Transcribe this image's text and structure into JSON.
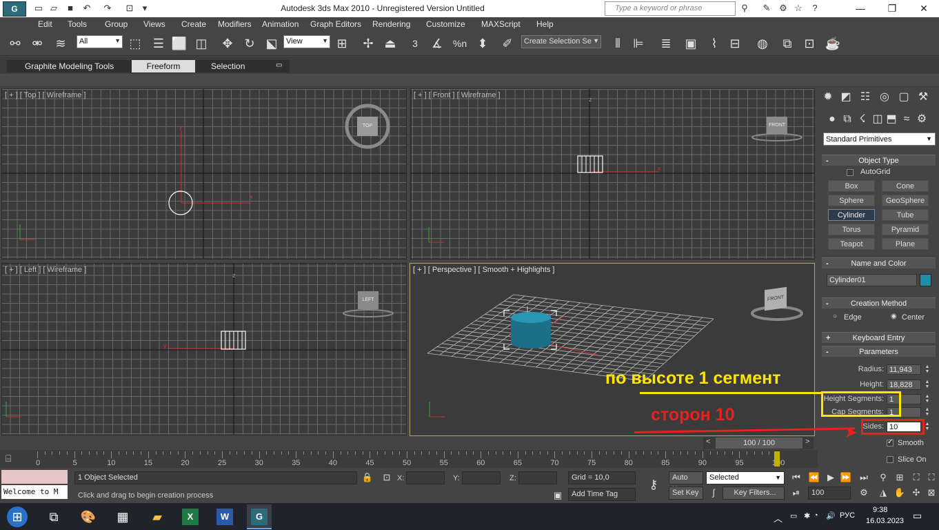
{
  "window": {
    "title": "Autodesk 3ds Max  2010   - Unregistered Version     Untitled",
    "search_placeholder": "Type a keyword or phrase"
  },
  "menu": [
    "Edit",
    "Tools",
    "Group",
    "Views",
    "Create",
    "Modifiers",
    "Animation",
    "Graph Editors",
    "Rendering",
    "Customize",
    "MAXScript",
    "Help"
  ],
  "toolbar": {
    "selection_filter": "All",
    "reference_coord": "View",
    "named_selection": "Create Selection Se",
    "snap_label": "3",
    "percent_snap": "%n"
  },
  "ribbon": {
    "tabs": [
      "Graphite Modeling Tools",
      "Freeform",
      "Selection"
    ],
    "active_tab": "Freeform"
  },
  "viewports": {
    "top": "[ + ] [ Top ] [ Wireframe ]",
    "front": "[ + ] [ Front ] [ Wireframe ]",
    "left": "[ + ] [ Left ] [ Wireframe ]",
    "perspective": "[ + ] [ Perspective ] [ Smooth + Highlights ]",
    "viewcube_top": "TOP",
    "viewcube_front": "FRONT",
    "viewcube_left": "LEFT",
    "axis_x": "x",
    "axis_y": "y",
    "axis_z": "z"
  },
  "command_panel": {
    "category_dropdown": "Standard Primitives",
    "object_type_title": "Object Type",
    "autogrid_label": "AutoGrid",
    "buttons": [
      "Box",
      "Cone",
      "Sphere",
      "GeoSphere",
      "Cylinder",
      "Tube",
      "Torus",
      "Pyramid",
      "Teapot",
      "Plane"
    ],
    "active_button": "Cylinder",
    "name_color_title": "Name and Color",
    "object_name": "Cylinder01",
    "object_color": "#1a8fa6",
    "creation_method_title": "Creation Method",
    "creation_edge": "Edge",
    "creation_center": "Center",
    "keyboard_entry_title": "Keyboard Entry",
    "parameters_title": "Parameters",
    "params": {
      "radius_label": "Radius:",
      "radius_value": "11,943",
      "height_label": "Height:",
      "height_value": "18,828",
      "height_segments_label": "Height Segments:",
      "height_segments_value": "1",
      "cap_segments_label": "Cap Segments:",
      "cap_segments_value": "1",
      "sides_label": "Sides:",
      "sides_value": "10",
      "smooth_label": "Smooth",
      "slice_on_label": "Slice On"
    }
  },
  "timeline": {
    "slider_label": "100 / 100",
    "ticks": [
      "0",
      "5",
      "10",
      "15",
      "20",
      "25",
      "30",
      "35",
      "40",
      "45",
      "50",
      "55",
      "60",
      "65",
      "70",
      "75",
      "80",
      "85",
      "90",
      "95",
      "100"
    ]
  },
  "status": {
    "welcome": "Welcome to M",
    "selected_count": "1 Object Selected",
    "prompt": "Click and drag to begin creation process",
    "x_label": "X:",
    "y_label": "Y:",
    "z_label": "Z:",
    "grid": "Grid = 10,0",
    "add_time_tag": "Add Time Tag",
    "auto_key": "Auto Key",
    "set_key": "Set Key",
    "key_mode": "Selected",
    "key_filters": "Key Filters...",
    "frame": "100"
  },
  "taskbar": {
    "language": "РУС",
    "time": "9:38",
    "date": "16.03.2023"
  },
  "annotations": {
    "height_note": "по высоте 1 сегмент",
    "sides_note": "сторон 10"
  }
}
